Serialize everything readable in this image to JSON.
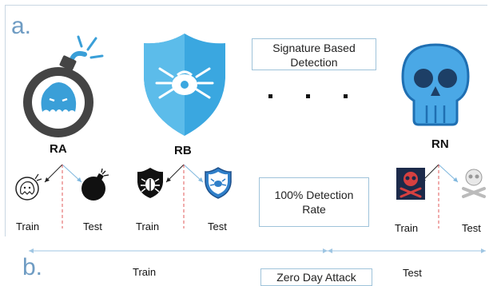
{
  "panels": {
    "a": "a.",
    "b": "b."
  },
  "models": [
    {
      "name": "RA",
      "icon": "bomb-virus-icon"
    },
    {
      "name": "RB",
      "icon": "shield-bug-icon"
    },
    {
      "name": "RN",
      "icon": "skull-icon"
    }
  ],
  "signature_box": {
    "line1": "Signature Based",
    "line2": "Detection"
  },
  "detection_box": {
    "line1": "100% Detection",
    "line2": "Rate"
  },
  "ellipsis_dots": 3,
  "split_labels": {
    "ra": {
      "train": "Train",
      "test": "Test"
    },
    "rb": {
      "train": "Train",
      "test": "Test"
    },
    "rn": {
      "train": "Train",
      "test": "Test"
    }
  },
  "timeline": {
    "train": "Train",
    "test": "Test",
    "zero_day": "Zero Day Attack"
  },
  "colors": {
    "accent_blue": "#3a9fd8",
    "panel_letter": "#6f9cc3",
    "split_red": "#e05a5a",
    "arrow_blue": "#7fb7de",
    "box_border": "#9fc3da"
  }
}
